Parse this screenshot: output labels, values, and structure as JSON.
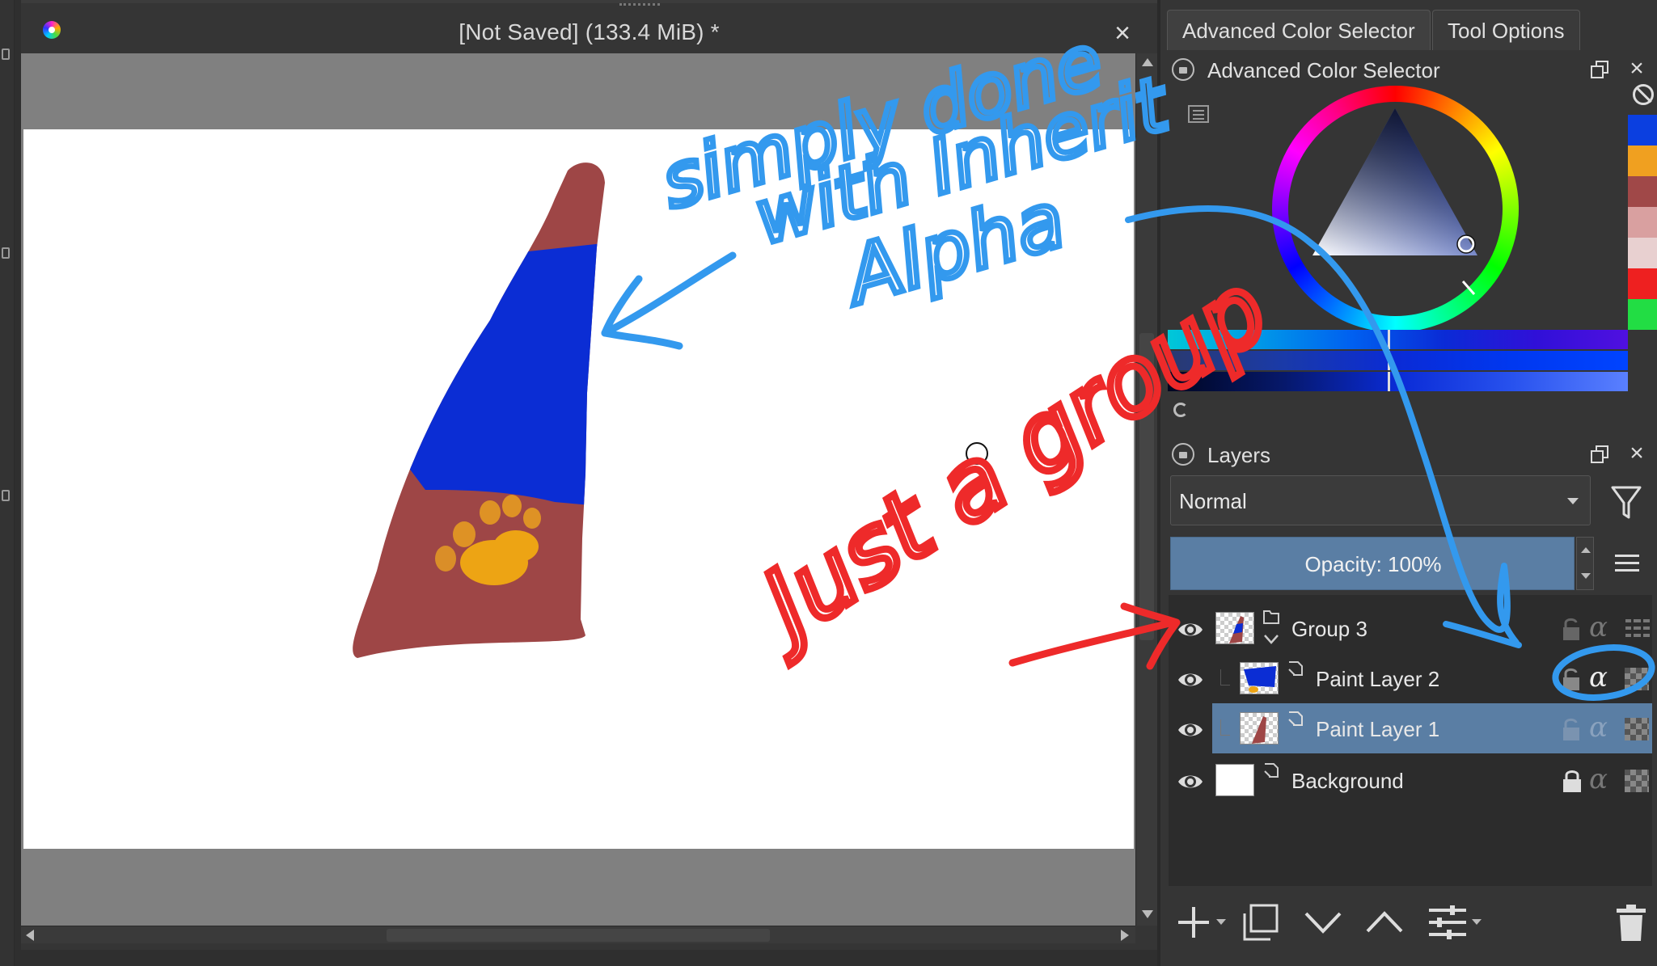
{
  "document": {
    "title": "[Not Saved]  (133.4 MiB)  *"
  },
  "dock": {
    "tabs": [
      {
        "label": "Advanced Color Selector",
        "active": true
      },
      {
        "label": "Tool Options",
        "active": false
      }
    ]
  },
  "color_selector": {
    "title": "Advanced Color Selector",
    "current_color": "#0a2bd6",
    "swatches": [
      "#0b3fe0",
      "#f0a020",
      "#a04848",
      "#d9a0a0",
      "#e8d0d0",
      "#ee2020",
      "#22dd44"
    ]
  },
  "layers": {
    "title": "Layers",
    "blend_mode": "Normal",
    "opacity_label": "Opacity:  100%",
    "items": [
      {
        "name": "Group 3",
        "type": "group",
        "selected": false
      },
      {
        "name": "Paint Layer 2",
        "type": "paint",
        "selected": false,
        "inherit_alpha": true
      },
      {
        "name": "Paint Layer 1",
        "type": "paint",
        "selected": true
      },
      {
        "name": "Background",
        "type": "paint",
        "selected": false,
        "locked": true
      }
    ],
    "alpha_glyph": "α"
  },
  "annotations": {
    "blue_note_line1": "simply done",
    "blue_note_line2": "with Inherit",
    "blue_note_line3": "Alpha",
    "red_note": "Just a group",
    "blue_color": "#3399ee",
    "red_color": "#ee2a2a"
  }
}
